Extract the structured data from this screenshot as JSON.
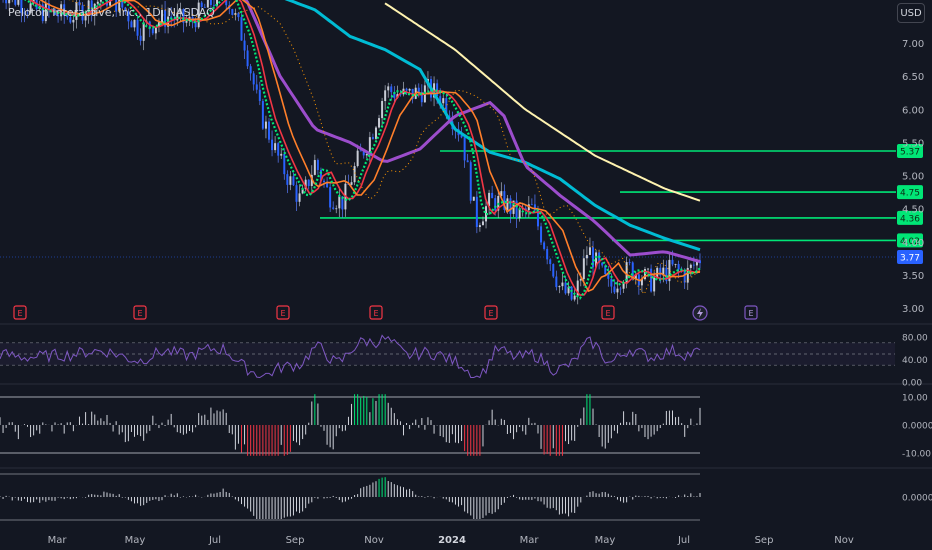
{
  "header": {
    "symbol_title": "Peloton Interactive, Inc., 1D, NASDAQ",
    "currency_label": "USD"
  },
  "colors": {
    "background": "#131722",
    "axis_text": "#b2b5be",
    "up_candle": "#c8ccd6",
    "down_candle": "#e0e3eb",
    "level_line": "#00e676",
    "last_price_badge": "#2962ff",
    "earnings_marker": "#f23645",
    "future_earnings_marker": "#7e57c2",
    "rsi_line": "#7e57c2",
    "ma_yellow": "#fff3b0",
    "ma_cyan": "#00bcd4",
    "ma_purple": "#9c4dcc",
    "ma_orange": "#ff7f2a",
    "ma_red": "#f23645",
    "ma_green": "#00e676",
    "dotted_orange": "#ff9800"
  },
  "chart_data": {
    "type": "line",
    "title": "Peloton Interactive, Inc., 1D, NASDAQ",
    "x_ticks": [
      "Mar",
      "May",
      "Jul",
      "Sep",
      "Nov",
      "2024",
      "Mar",
      "May",
      "Jul",
      "Sep",
      "Nov"
    ],
    "price_axis_ticks": [
      "7.00",
      "6.50",
      "6.00",
      "5.50",
      "5.00",
      "4.50",
      "4.00",
      "3.50",
      "3.00"
    ],
    "price_range": [
      2.9,
      7.4
    ],
    "horizontal_levels": [
      {
        "label": "5.37",
        "value": 5.37
      },
      {
        "label": "4.75",
        "value": 4.75
      },
      {
        "label": "4.36",
        "value": 4.36
      },
      {
        "label": "4.02",
        "value": 4.02
      }
    ],
    "last_price": {
      "label": "3.77",
      "value": 3.77
    },
    "price_series": {
      "name": "",
      "t": [
        0.0,
        0.05,
        0.1,
        0.15,
        0.17,
        0.2,
        0.24,
        0.27,
        0.3,
        0.32,
        0.35,
        0.37,
        0.4,
        0.43,
        0.45,
        0.47,
        0.49,
        0.51,
        0.53,
        0.55,
        0.58,
        0.61,
        0.63,
        0.66,
        0.68,
        0.7,
        0.72,
        0.74,
        0.76,
        0.78,
        0.8,
        0.82,
        0.84,
        0.87,
        0.9,
        0.93,
        0.96,
        0.98,
        1.0
      ],
      "values": [
        7.8,
        7.5,
        7.4,
        7.7,
        7.6,
        7.2,
        7.4,
        7.3,
        7.6,
        7.8,
        7.0,
        6.0,
        5.2,
        4.6,
        5.2,
        4.7,
        4.6,
        5.2,
        5.6,
        6.3,
        6.2,
        6.3,
        6.2,
        5.6,
        4.3,
        4.6,
        4.6,
        4.4,
        4.5,
        3.9,
        3.3,
        3.1,
        3.9,
        3.3,
        3.6,
        3.4,
        3.6,
        3.5,
        3.75
      ]
    },
    "moving_averages": [
      {
        "name": "",
        "color": "#fff3b0",
        "t": [
          0.55,
          0.65,
          0.75,
          0.85,
          0.95,
          1.0
        ],
        "values": [
          7.6,
          6.9,
          6.0,
          5.3,
          4.8,
          4.62
        ]
      },
      {
        "name": "",
        "color": "#00bcd4",
        "t": [
          0.4,
          0.45,
          0.5,
          0.55,
          0.6,
          0.65,
          0.7,
          0.75,
          0.8,
          0.85,
          0.9,
          0.95,
          1.0
        ],
        "values": [
          7.7,
          7.5,
          7.1,
          6.9,
          6.6,
          5.7,
          5.35,
          5.2,
          4.95,
          4.55,
          4.25,
          4.05,
          3.88
        ]
      },
      {
        "name": "",
        "color": "#9c4dcc",
        "t": [
          0.2,
          0.25,
          0.3,
          0.35,
          0.4,
          0.45,
          0.5,
          0.55,
          0.6,
          0.65,
          0.7,
          0.72,
          0.75,
          0.8,
          0.85,
          0.9,
          0.95,
          1.0
        ],
        "values": [
          7.7,
          7.8,
          7.75,
          7.7,
          6.5,
          5.7,
          5.5,
          5.2,
          5.4,
          5.9,
          6.1,
          5.9,
          5.15,
          4.7,
          4.3,
          3.8,
          3.85,
          3.7
        ]
      }
    ],
    "earnings_markers_count": 6,
    "rsi": {
      "axis_ticks": [
        "80.00",
        "40.00",
        "0.00"
      ],
      "range": [
        0,
        100
      ],
      "upper": 70,
      "lower": 30
    },
    "oscillator_1": {
      "axis_ticks": [
        "10.00",
        "0.0000",
        "-10.00"
      ],
      "range": [
        -12,
        12
      ]
    },
    "oscillator_2": {
      "axis_ticks": [
        "0.0000"
      ]
    }
  }
}
